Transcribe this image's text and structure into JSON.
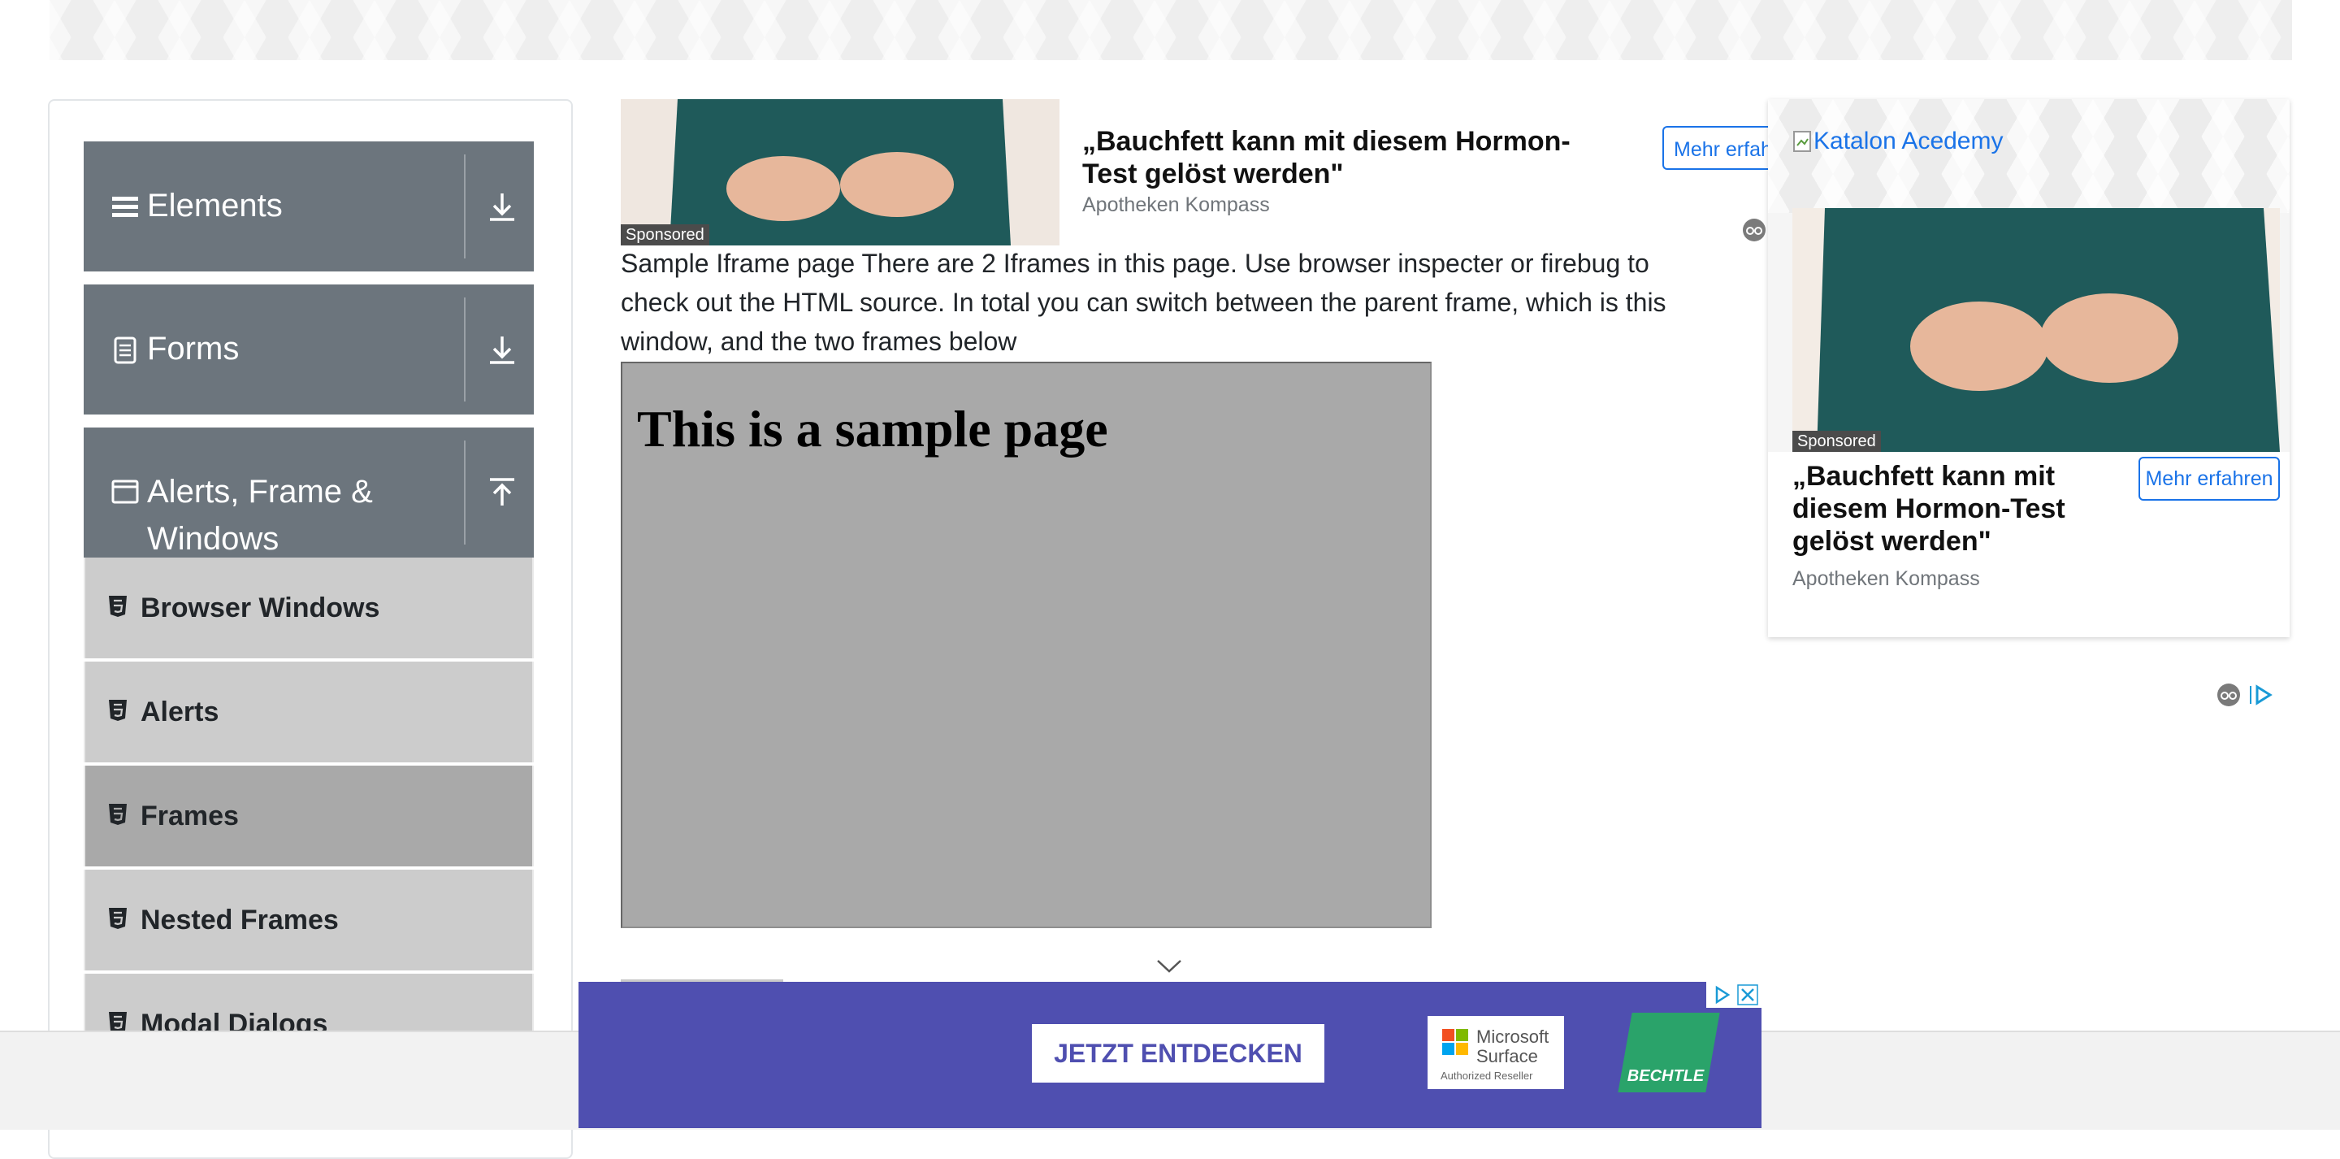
{
  "sidebar": {
    "groups": [
      {
        "label": "Elements",
        "icon": "hamburger-icon",
        "arrow": "download-icon"
      },
      {
        "label": "Forms",
        "icon": "document-icon",
        "arrow": "download-icon"
      },
      {
        "label_line1": "Alerts, Frame &",
        "label_line2": "Windows",
        "icon": "window-icon",
        "arrow": "upload-icon"
      }
    ],
    "items": [
      {
        "label": "Browser Windows",
        "active": false
      },
      {
        "label": "Alerts",
        "active": false
      },
      {
        "label": "Frames",
        "active": true
      },
      {
        "label": "Nested Frames",
        "active": false
      },
      {
        "label": "Modal Dialogs",
        "active": false
      }
    ]
  },
  "top_ad": {
    "headline": "„Bauchfett kann mit diesem Hormon-Test gelöst werden\"",
    "source": "Apotheken Kompass",
    "sponsored": "Sponsored",
    "button": "Mehr erfahren"
  },
  "main": {
    "intro": "Sample Iframe page There are 2 Iframes in this page. Use browser inspecter or firebug to check out the HTML source. In total you can switch between the parent frame, which is this window, and the two frames below",
    "iframe_heading": "This is a sample page"
  },
  "right_ad": {
    "alt_link": "Katalon Acedemy",
    "sponsored": "Sponsored",
    "headline": "„Bauchfett kann mit diesem Hormon-Test gelöst werden\"",
    "button": "Mehr erfahren",
    "source": "Apotheken Kompass"
  },
  "bottom_ad": {
    "cta": "JETZT ENTDECKEN",
    "partner_name": "Microsoft Surface",
    "partner_sub": "Authorized Reseller",
    "brand": "BECHTLE",
    "colors": {
      "background": "#4f4fb0",
      "brand_green": "#2aa36a"
    }
  },
  "colors": {
    "sidebar_header": "#6c757d",
    "menu_item": "#cccccc",
    "menu_item_active": "#a9a9a9",
    "iframe_bg": "#a9a9a9",
    "link": "#1a73e8"
  }
}
